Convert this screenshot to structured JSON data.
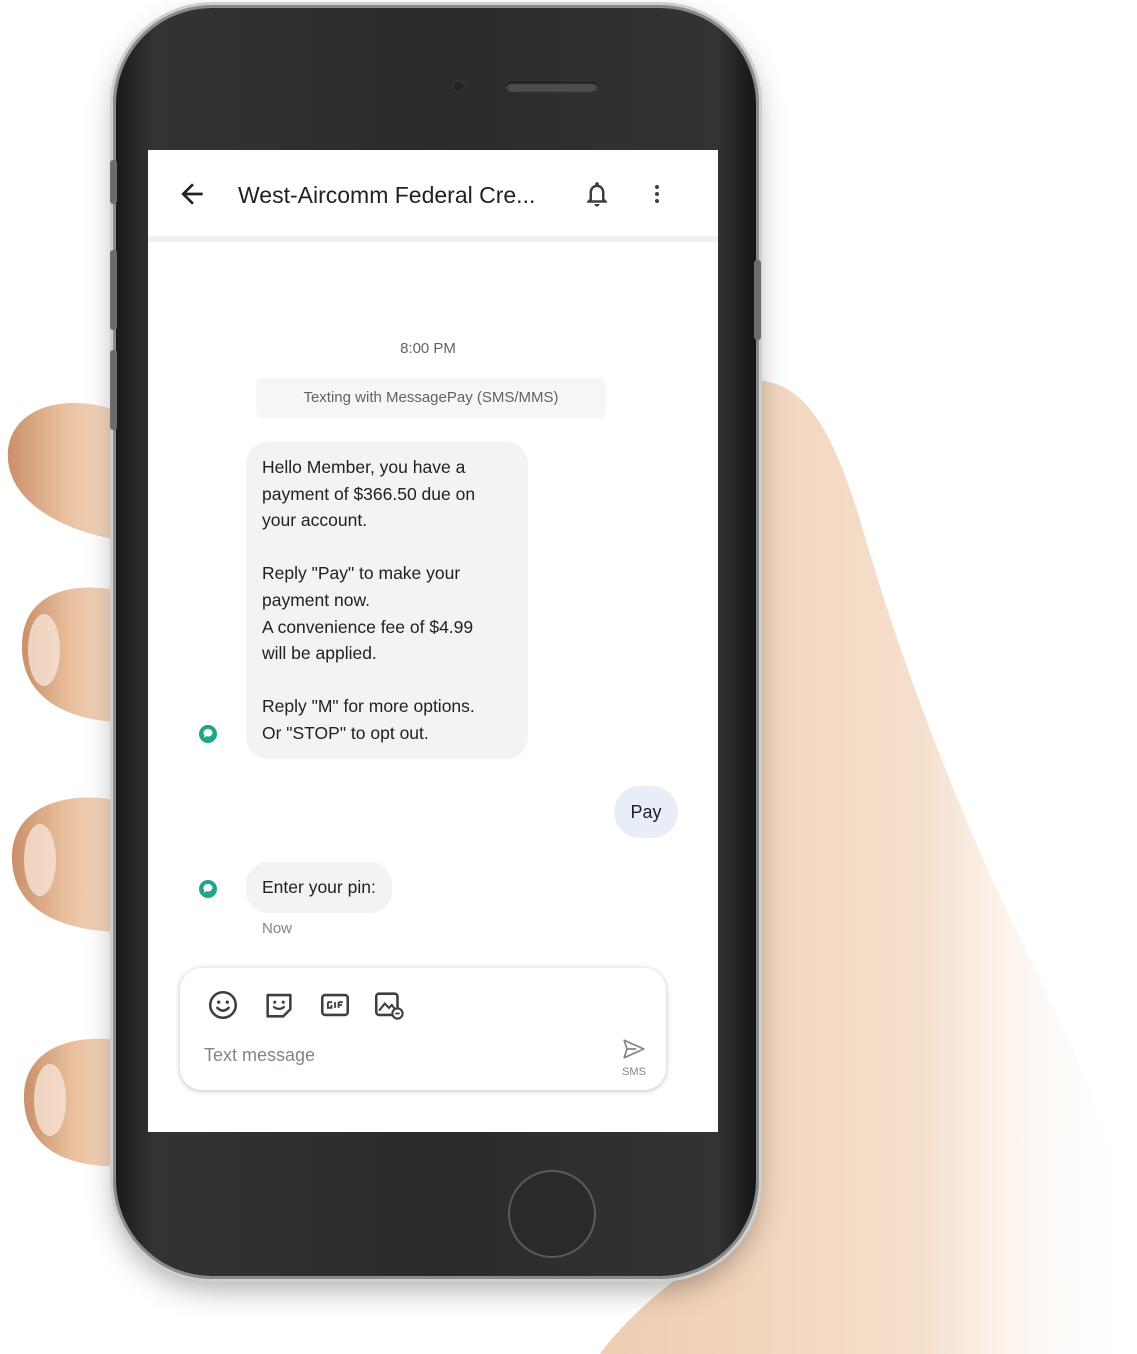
{
  "conversation": {
    "title": "West-Aircomm Federal Cre...",
    "timestamp": "8:00 PM",
    "info_chip": "Texting with MessagePay (SMS/MMS)"
  },
  "messages": [
    {
      "direction": "incoming",
      "lines": [
        "Hello Member, you have a",
        "payment of $366.50 due on",
        "your account.",
        "",
        "Reply \"Pay\" to make your",
        "payment now.",
        "A convenience fee of $4.99",
        "will be applied.",
        "",
        "Reply \"M\" for more options.",
        "Or \"STOP\" to opt out."
      ]
    },
    {
      "direction": "outgoing",
      "text": "Pay"
    },
    {
      "direction": "incoming",
      "text": "Enter your pin:",
      "time": "Now"
    }
  ],
  "compose": {
    "placeholder": "Text message",
    "send_label": "SMS",
    "tools": [
      "emoji-icon",
      "sticker-icon",
      "gif-icon",
      "image-gallery-icon"
    ]
  },
  "colors": {
    "incoming_bubble": "#f1f3f4",
    "outgoing_bubble": "#e8eef8",
    "avatar": "#1fa58a",
    "phone_body": "#2b2b2b"
  }
}
